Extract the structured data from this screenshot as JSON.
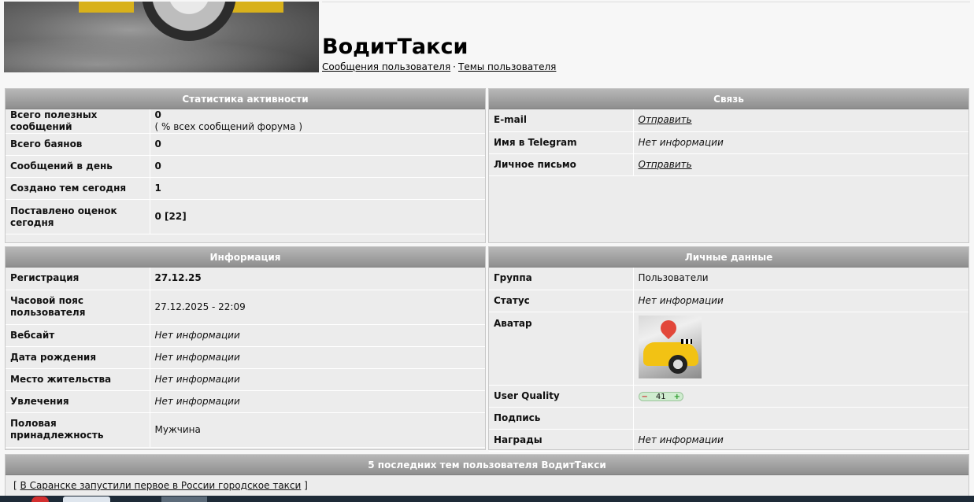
{
  "header": {
    "title": "ВодитТакси",
    "links": {
      "posts": "Сообщения пользователя",
      "separator": "·",
      "topics": "Темы пользователя"
    }
  },
  "activity": {
    "title": "Статистика активности",
    "rows": [
      {
        "label": "Всего полезных сообщений",
        "value": "0",
        "sub": "( % всех сообщений форума )"
      },
      {
        "label": "Всего баянов",
        "value": "0"
      },
      {
        "label": "Сообщений в день",
        "value": "0"
      },
      {
        "label": "Создано тем сегодня",
        "value": "1"
      },
      {
        "label": "Поставлено оценок сегодня",
        "value": "0 [22]"
      }
    ]
  },
  "contact": {
    "title": "Связь",
    "rows": [
      {
        "label": "E-mail",
        "value": "Отправить"
      },
      {
        "label": "Имя в Telegram",
        "value": "Нет информации"
      },
      {
        "label": "Личное письмо",
        "value": "Отправить"
      }
    ]
  },
  "info": {
    "title": "Информация",
    "rows": [
      {
        "label": "Регистрация",
        "value": "27.12.25"
      },
      {
        "label": "Часовой пояс пользователя",
        "value": "27.12.2025 - 22:09"
      },
      {
        "label": "Вебсайт",
        "value": "Нет информации"
      },
      {
        "label": "Дата рождения",
        "value": "Нет информации"
      },
      {
        "label": "Место жительства",
        "value": "Нет информации"
      },
      {
        "label": "Увлечения",
        "value": "Нет информации"
      },
      {
        "label": "Половая принадлежность",
        "value": "Мужчина"
      }
    ]
  },
  "personal": {
    "title": "Личные данные",
    "rows": [
      {
        "label": "Группа",
        "value": "Пользователи"
      },
      {
        "label": "Статус",
        "value": "Нет информации"
      },
      {
        "label": "Аватар",
        "value": ""
      },
      {
        "label": "User Quality",
        "value": "41",
        "minus": "−",
        "plus": "+"
      },
      {
        "label": "Подпись",
        "value": ""
      },
      {
        "label": "Награды",
        "value": "Нет информации"
      }
    ]
  },
  "recent": {
    "title": "5 последних тем пользователя ВодитТакси",
    "open_bracket": "[",
    "topic": "В Саранске запустили первое в России городское такси",
    "close_bracket": "]"
  },
  "icons": {
    "avatar": "taxi-avatar-image",
    "banner": "taxi-wheel-banner"
  }
}
